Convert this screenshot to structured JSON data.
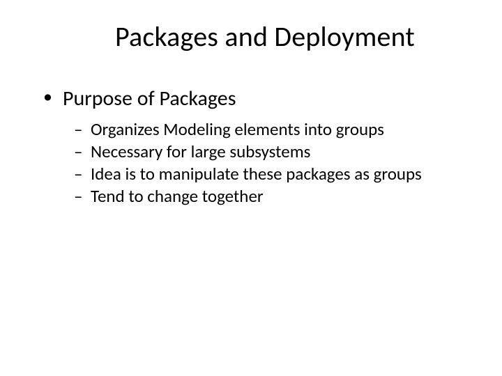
{
  "slide": {
    "title": "Packages and Deployment",
    "bullets": [
      {
        "text": "Purpose of Packages",
        "children": [
          "Organizes Modeling elements into groups",
          "Necessary for large subsystems",
          "Idea is to manipulate these packages as groups",
          "Tend to change together"
        ]
      }
    ]
  }
}
